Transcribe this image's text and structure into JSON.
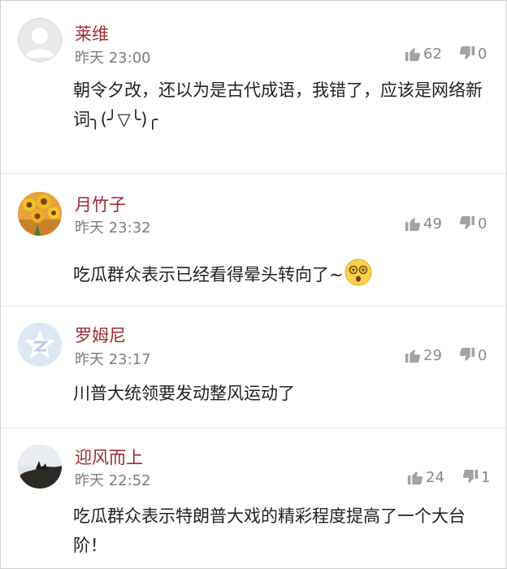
{
  "comments": [
    {
      "name": "莱维",
      "time": "昨天 23:00",
      "likes": "62",
      "dislikes": "0",
      "text": "朝令夕改，还以为是古代成语，我错了，应该是网络新词╮(╯▽╰)╭"
    },
    {
      "name": "月竹子",
      "time": "昨天 23:32",
      "likes": "49",
      "dislikes": "0",
      "text": "吃瓜群众表示已经看得晕头转向了~"
    },
    {
      "name": "罗姆尼",
      "time": "昨天 23:17",
      "likes": "29",
      "dislikes": "0",
      "text": "川普大统领要发动整风运动了"
    },
    {
      "name": "迎风而上",
      "time": "昨天 22:52",
      "likes": "24",
      "dislikes": "1",
      "text": "吃瓜群众表示特朗普大戏的精彩程度提高了一个大台阶！"
    }
  ],
  "colors": {
    "name": "#9b2c33",
    "meta": "#7d7d7d",
    "text": "#222222",
    "divider": "#e2e2e2"
  },
  "icons": [
    "default-avatar-icon",
    "sunflower-avatar",
    "qzone-avatar-icon",
    "landscape-avatar",
    "thumbs-up-icon",
    "thumbs-down-icon",
    "dizzy-face-emoji"
  ]
}
